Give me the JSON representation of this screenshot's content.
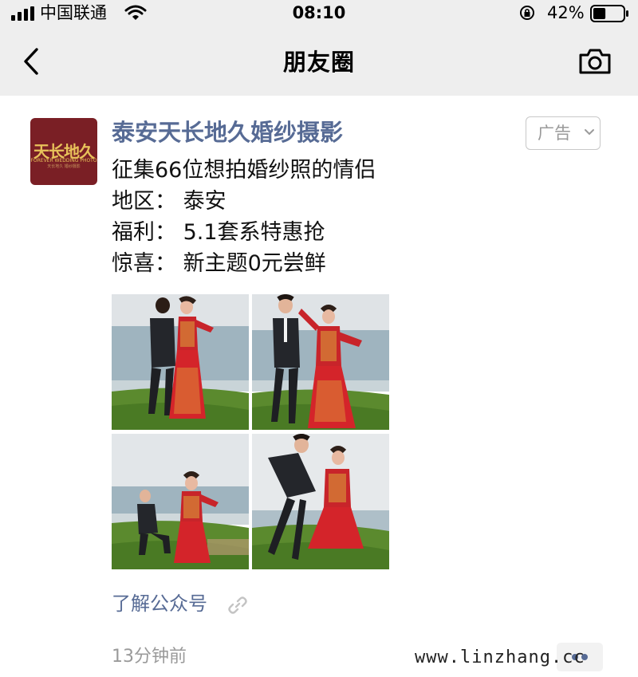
{
  "status_bar": {
    "carrier": "中国联通",
    "time": "08:10",
    "battery": "42%",
    "battery_level": 0.42
  },
  "nav": {
    "title": "朋友圈",
    "back_icon": "chevron-left-icon",
    "camera_icon": "camera-icon"
  },
  "post": {
    "author": "泰安天长地久婚纱摄影",
    "avatar": {
      "logo_text": "天长地久",
      "sub_text": "FOREVER WEDDING PHOTO",
      "sub_text_2": "天长地久 婚纱摄影"
    },
    "ad_label": "广告",
    "lines": [
      "征集66位想拍婚纱照的情侣",
      "地区： 泰安",
      "福利： 5.1套系特惠抢",
      "惊喜： 新主题0元尝鲜"
    ],
    "photos": [
      "wedding-photo-1",
      "wedding-photo-2",
      "wedding-photo-3",
      "wedding-photo-4"
    ],
    "learn_link": "了解公众号",
    "posted_time": "13分钟前"
  },
  "watermark": "www.linzhang.cc",
  "colors": {
    "link": "#576b95",
    "gray": "#9a9a9a",
    "header_bg": "#eeeeee",
    "dress_red": "#d4242a"
  }
}
